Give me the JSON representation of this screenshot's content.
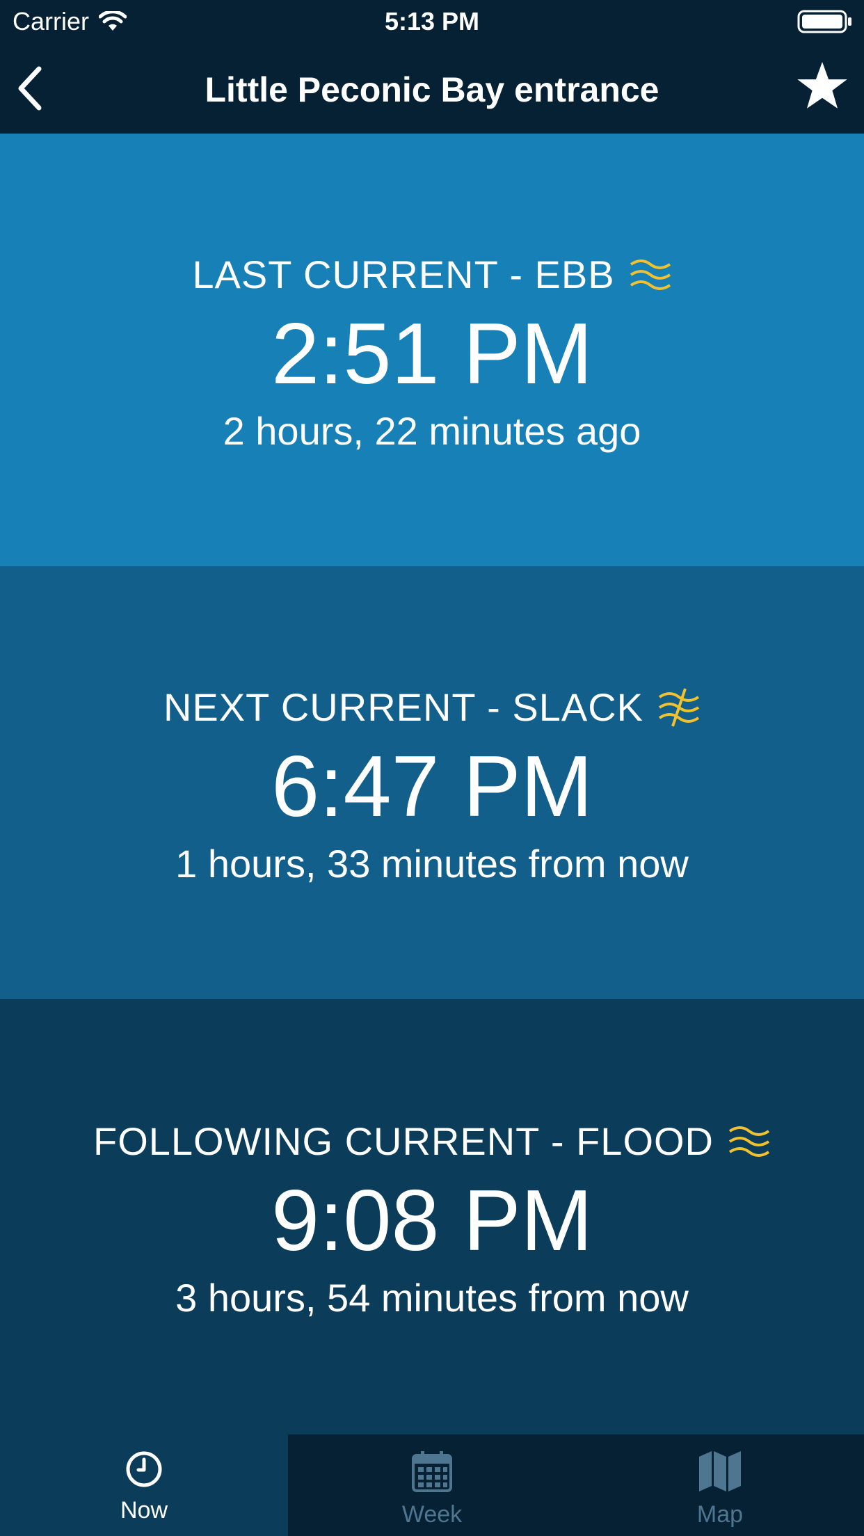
{
  "status_bar": {
    "carrier": "Carrier",
    "time": "5:13 PM"
  },
  "nav": {
    "title": "Little Peconic Bay entrance",
    "back_icon": "chevron-left-icon",
    "favorite_icon": "star-icon"
  },
  "panels": [
    {
      "label": "LAST CURRENT - EBB",
      "icon": "ebb-waves-icon",
      "time": "2:51 PM",
      "relative": "2 hours, 22 minutes ago"
    },
    {
      "label": "NEXT CURRENT - SLACK",
      "icon": "slack-waves-icon",
      "time": "6:47 PM",
      "relative": "1 hours, 33 minutes from now"
    },
    {
      "label": "FOLLOWING CURRENT - FLOOD",
      "icon": "flood-waves-icon",
      "time": "9:08 PM",
      "relative": "3 hours, 54 minutes from now"
    }
  ],
  "tabs": [
    {
      "label": "Now",
      "icon": "clock-icon",
      "active": true
    },
    {
      "label": "Week",
      "icon": "calendar-icon",
      "active": false
    },
    {
      "label": "Map",
      "icon": "map-icon",
      "active": false
    }
  ],
  "colors": {
    "bar_bg": "#062134",
    "panel_last": "#1680b7",
    "panel_next": "#125f8b",
    "panel_following": "#0b3d5b",
    "accent_yellow": "#f2c12e",
    "tab_inactive": "#4f7691"
  }
}
